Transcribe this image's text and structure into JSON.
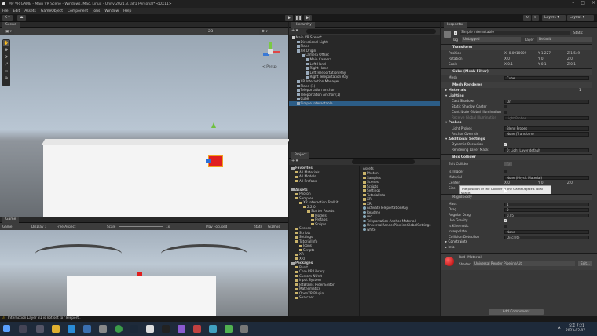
{
  "window": {
    "title": "My VR GAME - Main VR Scene - Windows, Mac, Linux - Unity 2021.3.18f1 Personal* <DX11>"
  },
  "menu": [
    "File",
    "Edit",
    "Assets",
    "GameObject",
    "Component",
    "Jobs",
    "Window",
    "Help"
  ],
  "toolbar": {
    "account": "K",
    "layers": "Layers",
    "layout": "Layout"
  },
  "scene": {
    "tab": "Scene",
    "view2d": "2D",
    "persp": "< Persp"
  },
  "game": {
    "tab": "Game",
    "display": "Game",
    "display_num": "Display 1",
    "aspect": "Free Aspect",
    "scale_label": "Scale",
    "scale_val": "1x",
    "play_mode": "Play Focused",
    "stats": "Stats",
    "gizmos": "Gizmos"
  },
  "hierarchy": {
    "tab": "Hierarchy",
    "items": [
      {
        "t": "Main VR Scene*",
        "d": 0
      },
      {
        "t": "Directional Light",
        "d": 1
      },
      {
        "t": "Plane",
        "d": 1
      },
      {
        "t": "XR Origin",
        "d": 1
      },
      {
        "t": "Camera Offset",
        "d": 2
      },
      {
        "t": "Main Camera",
        "d": 3
      },
      {
        "t": "Left Hand",
        "d": 3
      },
      {
        "t": "Right Hand",
        "d": 3
      },
      {
        "t": "Left Teleportation Ray",
        "d": 3
      },
      {
        "t": "Right Teleportation Ray",
        "d": 3
      },
      {
        "t": "XR Interaction Manager",
        "d": 1
      },
      {
        "t": "Plane (1)",
        "d": 1
      },
      {
        "t": "Teleportation Anchor",
        "d": 1
      },
      {
        "t": "Teleportation Anchor (1)",
        "d": 1
      },
      {
        "t": "Cube",
        "d": 1
      },
      {
        "t": "Simple Interactable",
        "d": 1
      }
    ]
  },
  "project": {
    "tab": "Project",
    "left": [
      {
        "t": "Favorites",
        "d": 0,
        "b": true
      },
      {
        "t": "All Materials",
        "d": 1
      },
      {
        "t": "All Models",
        "d": 1
      },
      {
        "t": "All Prefabs",
        "d": 1
      },
      {
        "t": "",
        "d": 0
      },
      {
        "t": "Assets",
        "d": 0,
        "b": true
      },
      {
        "t": "Photon",
        "d": 1
      },
      {
        "t": "Samples",
        "d": 1
      },
      {
        "t": "XR Interaction Toolkit",
        "d": 2
      },
      {
        "t": "2.2.0",
        "d": 3
      },
      {
        "t": "Starter Assets",
        "d": 4
      },
      {
        "t": "Models",
        "d": 5
      },
      {
        "t": "Prefabs",
        "d": 5
      },
      {
        "t": "Scripts",
        "d": 5
      },
      {
        "t": "Scenes",
        "d": 1
      },
      {
        "t": "Scripts",
        "d": 1
      },
      {
        "t": "Settings",
        "d": 1
      },
      {
        "t": "TutorialInfo",
        "d": 1
      },
      {
        "t": "Icons",
        "d": 2
      },
      {
        "t": "Scripts",
        "d": 2
      },
      {
        "t": "XR",
        "d": 1
      },
      {
        "t": "XRI",
        "d": 1
      },
      {
        "t": "Packages",
        "d": 0,
        "b": true
      },
      {
        "t": "Burst",
        "d": 1
      },
      {
        "t": "Core RP Library",
        "d": 1
      },
      {
        "t": "Custom NUnit",
        "d": 1
      },
      {
        "t": "Input System",
        "d": 1
      },
      {
        "t": "JetBrains Rider Editor",
        "d": 1
      },
      {
        "t": "Mathematics",
        "d": 1
      },
      {
        "t": "OpenXR Plugin",
        "d": 1
      },
      {
        "t": "Searcher",
        "d": 1
      }
    ],
    "assets_label": "Assets",
    "right": [
      {
        "t": "Photon",
        "f": true
      },
      {
        "t": "Samples",
        "f": true
      },
      {
        "t": "Scenes",
        "f": true
      },
      {
        "t": "Scripts",
        "f": true
      },
      {
        "t": "Settings",
        "f": true
      },
      {
        "t": "TutorialInfo",
        "f": true
      },
      {
        "t": "XR",
        "f": true
      },
      {
        "t": "XRI",
        "f": true
      },
      {
        "t": "ActivateTeleportationRay",
        "f": false
      },
      {
        "t": "Readme",
        "f": false
      },
      {
        "t": "red",
        "f": false
      },
      {
        "t": "Teleportation Anchor Material",
        "f": false
      },
      {
        "t": "UniversalRenderPipelineGlobalSettings",
        "f": false
      },
      {
        "t": "white",
        "f": false
      }
    ]
  },
  "inspector": {
    "tab": "Inspector",
    "name": "Simple Interactable",
    "static": "Static",
    "tag_label": "Tag",
    "tag": "Untagged",
    "layer_label": "Layer",
    "layer": "Default",
    "transform": "Transform",
    "pos_label": "Position",
    "pos": [
      "-0.0910009",
      "1.227",
      "1.549"
    ],
    "rot_label": "Rotation",
    "rot": [
      "0",
      "0",
      "0"
    ],
    "scale_label": "Scale",
    "scl": [
      "0.1",
      "0.1",
      "0.1"
    ],
    "meshfilter": "Cube (Mesh Filter)",
    "mesh_label": "Mesh",
    "mesh": "Cube",
    "meshrenderer": "Mesh Renderer",
    "materials": "Materials",
    "mat_count": "1",
    "lighting": "Lighting",
    "cast_shadows": "Cast Shadows",
    "cast_val": "On",
    "static_caster": "Static Shadow Caster",
    "contrib_gi": "Contribute Global Illumination",
    "receive_gi": "Receive Global Illumination",
    "receive_val": "Light Probes",
    "probes": "Probes",
    "light_probes": "Light Probes",
    "light_probes_val": "Blend Probes",
    "anchor_override": "Anchor Override",
    "anchor_val": "None (Transform)",
    "add_settings": "Additional Settings",
    "dyn_occ": "Dynamic Occlusion",
    "render_layer": "Rendering Layer Mask",
    "render_layer_val": "0: Light Layer default",
    "boxcollider": "Box Collider",
    "edit_collider": "Edit Collider",
    "is_trigger": "Is Trigger",
    "material": "Material",
    "material_val": "None (Physic Material)",
    "center": "Center",
    "center_v": [
      "0",
      "0",
      "0"
    ],
    "size": "Size",
    "tooltip": "The position of the Collider in the GameObject's local space.",
    "rb_partial": "Rigidbody",
    "mass": "Mass",
    "mass_v": "1",
    "drag": "Drag",
    "drag_v": "0",
    "ang_drag": "Angular Drag",
    "ang_drag_v": "0.05",
    "use_gravity": "Use Gravity",
    "is_kinematic": "Is Kinematic",
    "interpolate": "Interpolate",
    "interp_v": "None",
    "collision": "Collision Detection",
    "collision_v": "Discrete",
    "constraints": "Constraints",
    "info": "Info",
    "red_mat": "Red (Material)",
    "shader_label": "Shader",
    "shader": "Universal Render Pipeline/Lit",
    "edit": "Edit...",
    "add_component": "Add Component"
  },
  "status": {
    "message": "Interaction Layer 31 is not set to 'Teleport'."
  },
  "taskbar": {
    "lang": "A",
    "time": "오후 7:21",
    "date": "2023-02-07"
  },
  "colors": {
    "accent": "#3a79bb",
    "scene_sky": "#b5c4d2",
    "ground": "#6f7378",
    "cube": "#e02020"
  }
}
